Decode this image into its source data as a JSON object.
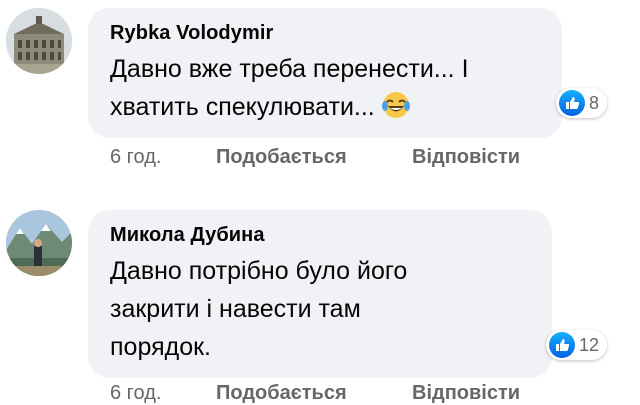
{
  "comments": [
    {
      "author": "Rybka Volodymir",
      "text_line1": "Давно вже треба перенести... І",
      "text_line2": "хватить спекулювати...",
      "emoji": "laughing-tears-emoji",
      "reaction_count": "8",
      "time": "6 год.",
      "like_label": "Подобається",
      "reply_label": "Відповісти"
    },
    {
      "author": "Микола Дубина",
      "text_line1": "Давно потрібно було його",
      "text_line2": "закрити і навести там",
      "text_line3": "порядок.",
      "reaction_count": "12",
      "time": "6 год.",
      "like_label": "Подобається",
      "reply_label": "Відповісти"
    }
  ],
  "colors": {
    "bubble_bg": "#f0f2f5",
    "secondary_text": "#65676b",
    "like_blue": "#1877f2"
  }
}
